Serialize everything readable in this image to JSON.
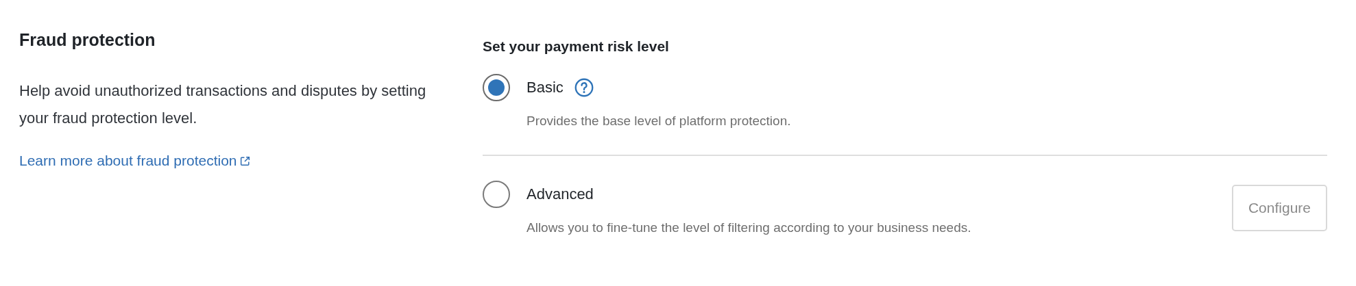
{
  "intro": {
    "title": "Fraud protection",
    "description": "Help avoid unauthorized transactions and disputes by setting your fraud protection level.",
    "link": "Learn more about fraud protection"
  },
  "risk": {
    "heading": "Set your payment risk level",
    "options": [
      {
        "label": "Basic",
        "description": "Provides the base level of platform protection.",
        "selected": true,
        "help": true
      },
      {
        "label": "Advanced",
        "description": "Allows you to fine-tune the level of filtering according to your business needs.",
        "selected": false,
        "help": false,
        "button": {
          "label": "Configure",
          "disabled": true
        }
      }
    ]
  }
}
